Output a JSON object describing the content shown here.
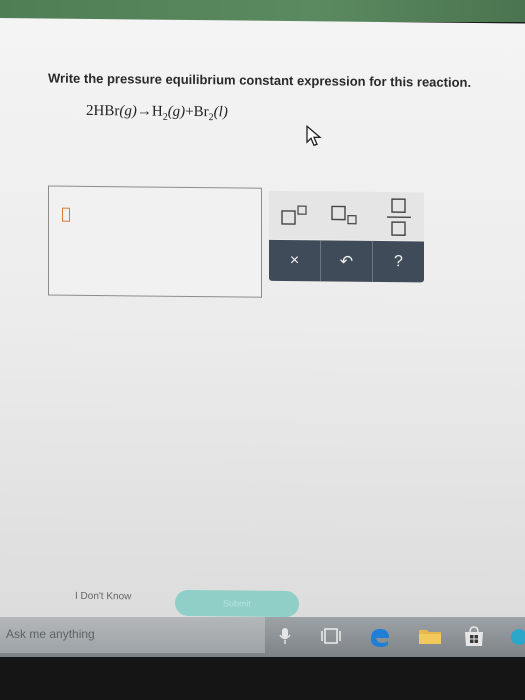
{
  "question": {
    "prompt": "Write the pressure equilibrium constant expression for this reaction.",
    "reaction": {
      "coef": "2",
      "reactant": "HBr",
      "reactant_state": "(g)",
      "arrow": "→",
      "product1": "H",
      "product1_sub": "2",
      "product1_state": "(g)",
      "plus": "+",
      "product2": "Br",
      "product2_sub": "2",
      "product2_state": "(l)"
    }
  },
  "palette": {
    "actions": {
      "clear": "×",
      "undo": "↶",
      "help": "?"
    }
  },
  "footer": {
    "dont_know": "I Don't Know",
    "submit": "Submit"
  },
  "taskbar": {
    "search_placeholder": "Ask me anything"
  },
  "colors": {
    "palette_dark": "#3f4b58",
    "submit": "#8fcfc8",
    "caret": "#d77a3a"
  }
}
